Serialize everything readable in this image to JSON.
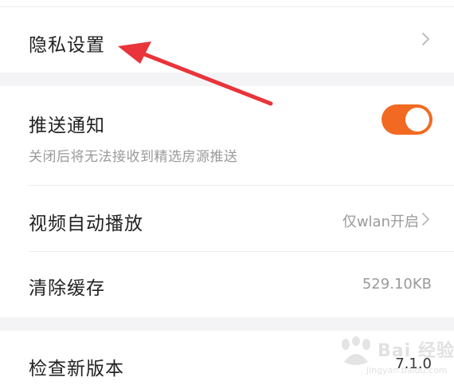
{
  "settings": {
    "privacy": {
      "label": "隐私设置"
    },
    "push": {
      "label": "推送通知",
      "description": "关闭后将无法接收到精选房源推送",
      "enabled": true
    },
    "autoplay": {
      "label": "视频自动播放",
      "value": "仅wlan开启"
    },
    "cache": {
      "label": "清除缓存",
      "value": "529.10KB"
    },
    "version": {
      "label": "检查新版本",
      "value": "7.1.0"
    }
  },
  "colors": {
    "toggle_on": "#f26a22",
    "annotation_arrow": "#e8343a",
    "section_gap": "#f4f4f6"
  },
  "watermark": {
    "text": "Bai 经验",
    "subtext": "jingyan.baidu.com"
  }
}
